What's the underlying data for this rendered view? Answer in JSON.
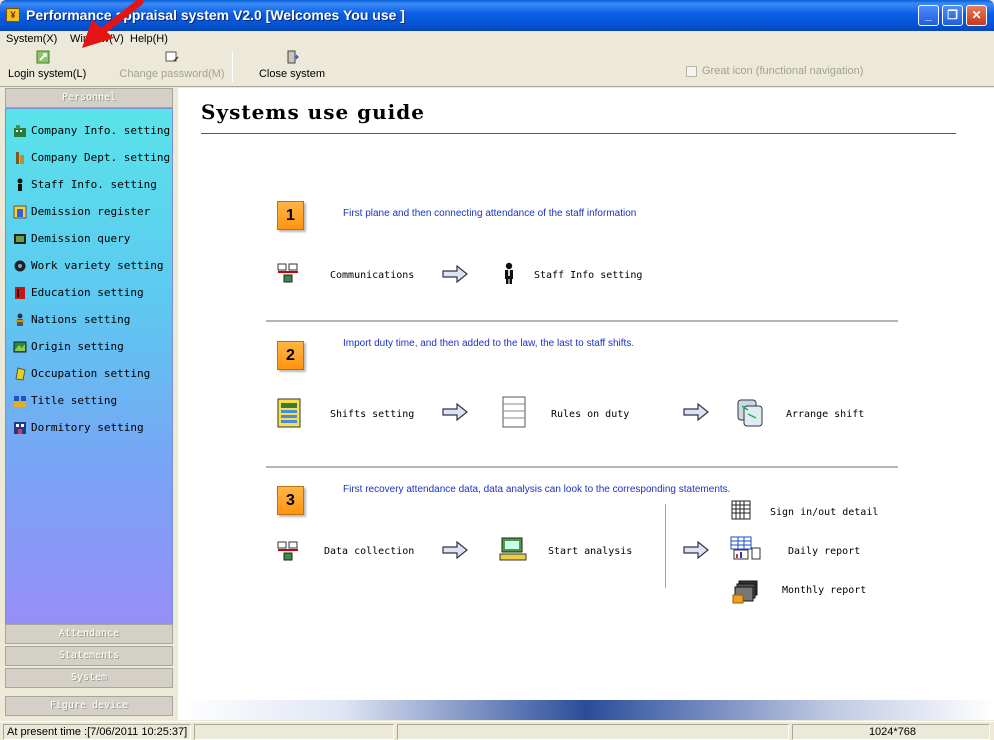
{
  "window": {
    "title": "Performance appraisal system V2.0 [Welcomes You use ]",
    "minimize_icon": "minimize-icon",
    "restore_icon": "restore-icon",
    "close_icon": "close-icon"
  },
  "menubar": {
    "items": [
      {
        "label": "System(X)"
      },
      {
        "label": "Window(V)"
      },
      {
        "label": "Help(H)"
      }
    ]
  },
  "toolbar": {
    "login": {
      "label": "Login system(L)",
      "icon": "login-icon"
    },
    "change_password": {
      "label": "Change password(M)",
      "icon": "change-password-icon",
      "enabled": false
    },
    "close": {
      "label": "Close system",
      "icon": "door-exit-icon"
    },
    "great_icon": {
      "label": "Great icon (functional navigation)",
      "checked": false,
      "enabled": false
    }
  },
  "sidebar": {
    "sections": [
      {
        "label": "Personnel"
      },
      {
        "label": "Attendance"
      },
      {
        "label": "Statements"
      },
      {
        "label": "System"
      },
      {
        "label": "Figure device"
      }
    ],
    "items": [
      {
        "label": "Company Info. setting",
        "icon": "company-icon"
      },
      {
        "label": "Company Dept. setting",
        "icon": "department-icon"
      },
      {
        "label": "Staff Info. setting",
        "icon": "staff-icon"
      },
      {
        "label": "Demission register",
        "icon": "demission-register-icon"
      },
      {
        "label": "Demission query",
        "icon": "demission-query-icon"
      },
      {
        "label": "Work variety setting",
        "icon": "work-variety-icon"
      },
      {
        "label": "Education setting",
        "icon": "education-icon"
      },
      {
        "label": "Nations setting",
        "icon": "nations-icon"
      },
      {
        "label": "Origin setting",
        "icon": "origin-icon"
      },
      {
        "label": "Occupation setting",
        "icon": "occupation-icon"
      },
      {
        "label": "Title setting",
        "icon": "title-icon"
      },
      {
        "label": "Dormitory setting",
        "icon": "dormitory-icon"
      }
    ]
  },
  "guide": {
    "title": "Systems use guide",
    "steps": [
      {
        "number": "1",
        "description": "First plane and then connecting attendance of the staff information",
        "flow": [
          {
            "label": "Communications",
            "icon": "communications-icon"
          },
          {
            "label": "Staff Info setting",
            "icon": "staff-info-icon"
          }
        ]
      },
      {
        "number": "2",
        "description": "Import duty time, and then added to the law, the last to staff shifts.",
        "flow": [
          {
            "label": "Shifts setting",
            "icon": "shifts-icon"
          },
          {
            "label": "Rules on duty",
            "icon": "rules-icon"
          },
          {
            "label": "Arrange shift",
            "icon": "arrange-shift-icon"
          }
        ]
      },
      {
        "number": "3",
        "description": "First recovery attendance data, data analysis can look to the corresponding statements.",
        "flow": [
          {
            "label": "Data collection",
            "icon": "data-collection-icon"
          },
          {
            "label": "Start analysis",
            "icon": "analysis-icon"
          }
        ],
        "reports": [
          {
            "label": "Sign in/out detail",
            "icon": "sign-detail-icon"
          },
          {
            "label": "Daily report",
            "icon": "daily-report-icon"
          },
          {
            "label": "Monthly report",
            "icon": "monthly-report-icon"
          }
        ]
      }
    ]
  },
  "statusbar": {
    "time": "At present time :[7/06/2011 10:25:37]",
    "resolution": "1024*768"
  },
  "colors": {
    "title_bar": "#0b5ee6",
    "step_badge": "#ff9c20",
    "guide_text": "#1a33c0",
    "annotation_arrow": "#e41414"
  }
}
